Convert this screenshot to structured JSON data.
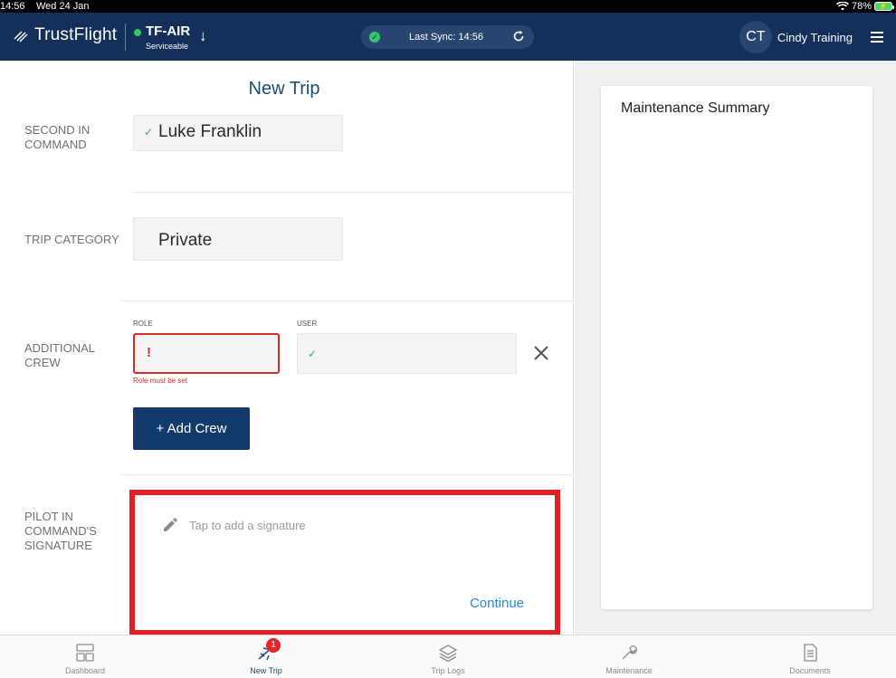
{
  "status_bar": {
    "time": "14:56",
    "date": "Wed 24 Jan",
    "battery": "78%"
  },
  "header": {
    "brand": "TrustFlight",
    "aircraft_reg": "TF-AIR",
    "aircraft_status": "Serviceable",
    "sync_text": "Last Sync: 14:56",
    "user_initials": "CT",
    "user_name": "Cindy Training"
  },
  "page": {
    "title": "New Trip"
  },
  "form": {
    "second_in_command": {
      "label": "SECOND IN COMMAND",
      "value": "Luke Franklin"
    },
    "trip_category": {
      "label": "TRIP CATEGORY",
      "value": "Private"
    },
    "additional_crew": {
      "label": "ADDITIONAL CREW",
      "role_label": "ROLE",
      "user_label": "USER",
      "role_error": "Role must be set",
      "add_button": "+ Add Crew"
    },
    "signature": {
      "label": "PILOT IN COMMAND'S SIGNATURE",
      "hint": "Tap to add a signature",
      "continue": "Continue"
    }
  },
  "side_panel": {
    "title": "Maintenance Summary"
  },
  "tabs": [
    {
      "label": "Dashboard",
      "icon": "dashboard-icon"
    },
    {
      "label": "New Trip",
      "icon": "plane-icon",
      "badge": "1"
    },
    {
      "label": "Trip Logs",
      "icon": "layers-icon"
    },
    {
      "label": "Maintenance",
      "icon": "wrench-icon"
    },
    {
      "label": "Documents",
      "icon": "document-icon"
    }
  ],
  "colors": {
    "header": "#14305a",
    "accent": "#1c4b73",
    "error": "#d92a2a",
    "success": "#37c46a",
    "highlight": "#e31e24"
  }
}
